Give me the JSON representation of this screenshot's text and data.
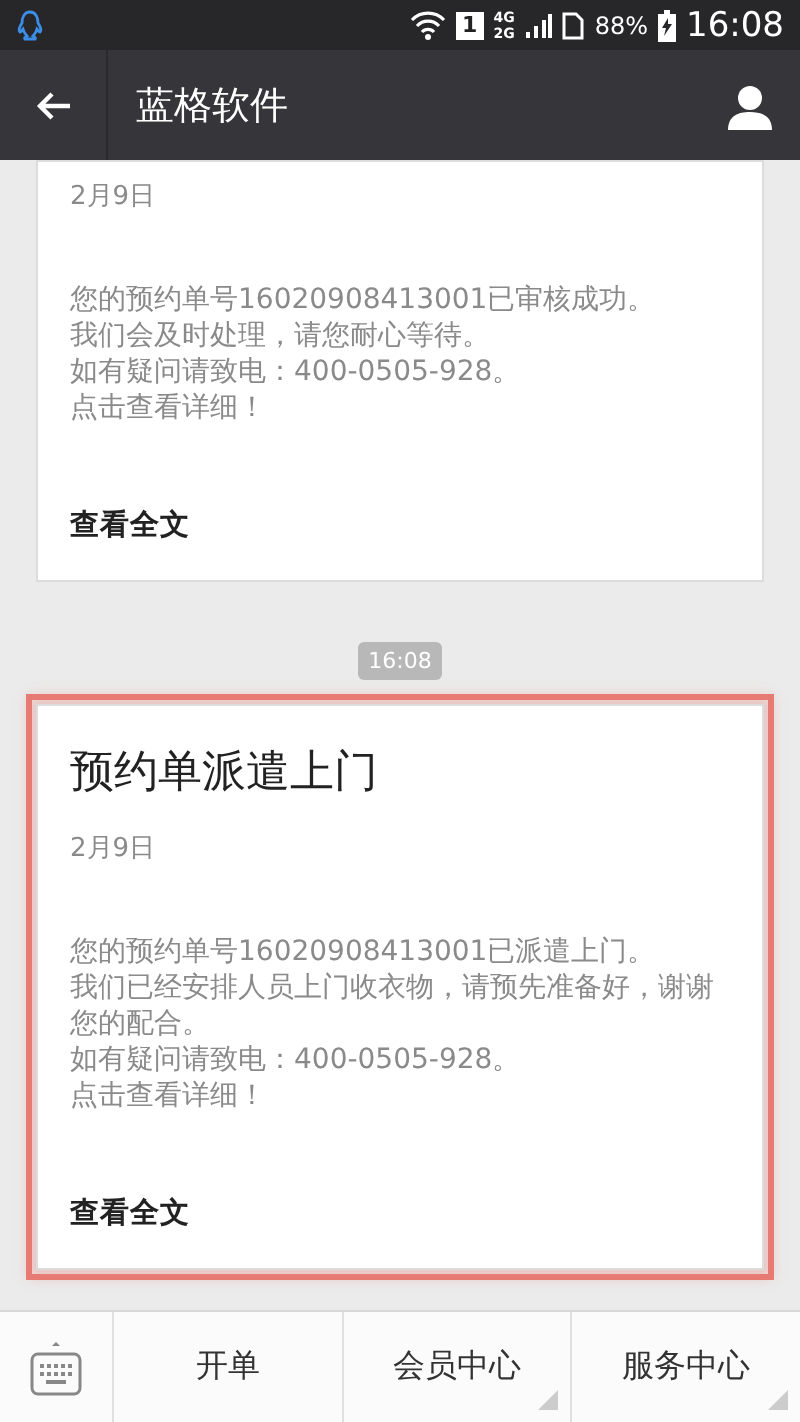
{
  "status_bar": {
    "sim": "1",
    "network_top": "4G",
    "network_bottom": "2G",
    "battery": "88%",
    "time": "16:08"
  },
  "header": {
    "title": "蓝格软件"
  },
  "messages": [
    {
      "date": "2月9日",
      "body": [
        "您的预约单号16020908413001已审核成功。",
        "我们会及时处理，请您耐心等待。",
        "如有疑问请致电：400-0505-928。",
        "点击查看详细！"
      ],
      "link": "查看全文",
      "highlighted": false
    },
    {
      "time": "16:08",
      "title": "预约单派遣上门",
      "date": "2月9日",
      "body": [
        "您的预约单号16020908413001已派遣上门。",
        "我们已经安排人员上门收衣物，请预先准备好，谢谢您的配合。",
        "如有疑问请致电：400-0505-928。",
        "点击查看详细！"
      ],
      "link": "查看全文",
      "highlighted": true
    }
  ],
  "menu": [
    {
      "label": "开单",
      "kind": "action"
    },
    {
      "label": "会员中心",
      "kind": "submenu"
    },
    {
      "label": "服务中心",
      "kind": "submenu"
    }
  ]
}
